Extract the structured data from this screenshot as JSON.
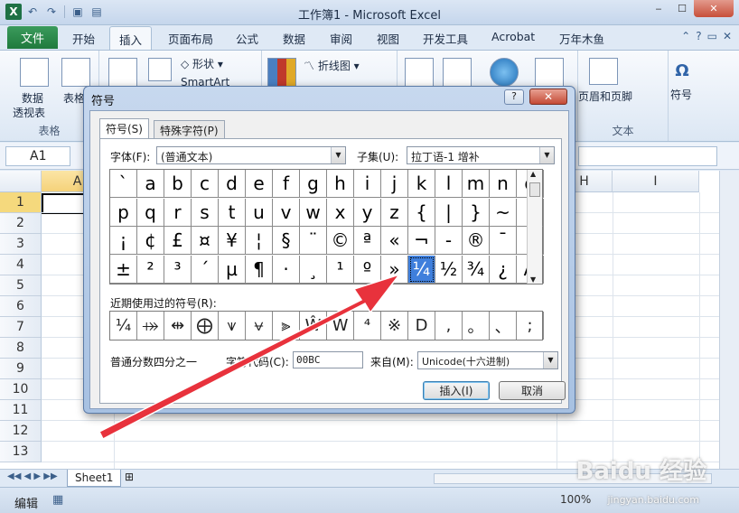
{
  "window": {
    "title": "工作簿1 - Microsoft Excel",
    "app_icon": "X",
    "min": "‒",
    "max": "☐",
    "close": "✕"
  },
  "qat": {
    "undo": "↶",
    "redo": "↷",
    "save": "▣",
    "open": "▤"
  },
  "ribbon": {
    "tabs": [
      "文件",
      "开始",
      "插入",
      "页面布局",
      "公式",
      "数据",
      "审阅",
      "视图",
      "开发工具",
      "Acrobat",
      "万年木鱼"
    ],
    "active_tab": "插入",
    "groups": {
      "pivot_label_1": "数据",
      "pivot_label_2": "透视表",
      "table_label": "表格",
      "group_table": "表格",
      "shapes_label": "形状",
      "smartart_label": "SmartArt",
      "line_chart_label": "折线图",
      "header_footer_label": "页眉和页脚",
      "symbol_label": "符号",
      "symbol_glyph": "Ω",
      "text_group": "文本"
    }
  },
  "formula_bar": {
    "name_box": "A1",
    "fx": "fx"
  },
  "grid": {
    "columns": [
      "A",
      "H",
      "I"
    ],
    "rows": [
      "1",
      "2",
      "3",
      "4",
      "5",
      "6",
      "7",
      "8",
      "9",
      "10",
      "11",
      "12",
      "13"
    ]
  },
  "sheet": {
    "tab": "Sheet1"
  },
  "status": {
    "mode": "编辑",
    "zoom": "100%"
  },
  "dialog": {
    "title": "符号",
    "help": "?",
    "close": "✕",
    "tabs": [
      "符号(S)",
      "特殊字符(P)"
    ],
    "font_label": "字体(F):",
    "font_value": "(普通文本)",
    "subset_label": "子集(U):",
    "subset_value": "拉丁语-1 增补",
    "symbols": [
      [
        "`",
        "a",
        "b",
        "c",
        "d",
        "e",
        "f",
        "g",
        "h",
        "i",
        "j",
        "k",
        "l",
        "m",
        "n",
        "o"
      ],
      [
        "p",
        "q",
        "r",
        "s",
        "t",
        "u",
        "v",
        "w",
        "x",
        "y",
        "z",
        "{",
        "|",
        "}",
        "~",
        ""
      ],
      [
        "¡",
        "¢",
        "£",
        "¤",
        "¥",
        "¦",
        "§",
        "¨",
        "©",
        "ª",
        "«",
        "¬",
        "-",
        "®",
        "¯",
        "°"
      ],
      [
        "±",
        "²",
        "³",
        "´",
        "µ",
        "¶",
        "·",
        "¸",
        "¹",
        "º",
        "»",
        "¼",
        "½",
        "¾",
        "¿",
        "À"
      ]
    ],
    "selected_symbol": "¼",
    "recent_label": "近期使用过的符号(R):",
    "recent": [
      "¼",
      "⤀",
      "⇹",
      "⨁",
      "⩛",
      "⩝",
      "⫸",
      "Ŵ",
      "W",
      "⁴",
      "※",
      "D",
      ",",
      "。",
      "、",
      ";"
    ],
    "char_name": "普通分数四分之一",
    "code_label": "字符代码(C):",
    "code_value": "00BC",
    "from_label": "来自(M):",
    "from_value": "Unicode(十六进制)",
    "insert_button": "插入(I)",
    "cancel_button": "取消"
  },
  "watermark": {
    "text": "Baidu 经验",
    "sub": "jingyan.baidu.com"
  },
  "colors": {
    "arrow": "#e8323c",
    "selection": "#3f7fdc",
    "file_tab": "#1f7a3d"
  }
}
